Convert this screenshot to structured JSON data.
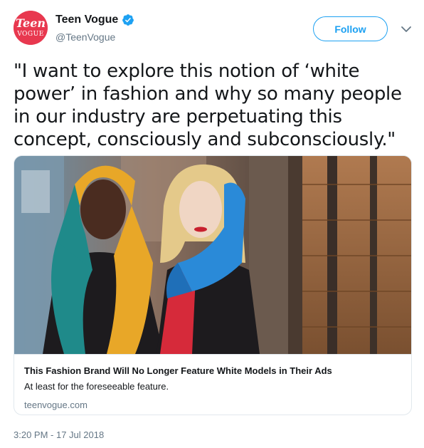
{
  "tweet": {
    "author": {
      "display_name": "Teen Vogue",
      "handle": "@TeenVogue",
      "avatar_text_top": "Teen",
      "avatar_text_bottom": "VOGUE",
      "verified": true
    },
    "follow_label": "Follow",
    "text": "\"I want to explore this notion of ‘white power’ in fashion and why so many people in our industry are perpetuating this concept, consciously and subconsciously.\"",
    "timestamp": "3:20 PM - 17 Jul 2018"
  },
  "card": {
    "title": "This Fashion Brand Will No Longer Feature White Models in Their Ads",
    "description": "At least for the foreseeable feature.",
    "domain": "teenvogue.com"
  },
  "colors": {
    "accent": "#1da1f2",
    "brand": "#e8384f",
    "text": "#14171a",
    "muted": "#657786",
    "border": "#e1e8ed"
  },
  "icons": {
    "verified": "verified-badge-icon",
    "caret": "chevron-down-icon"
  }
}
